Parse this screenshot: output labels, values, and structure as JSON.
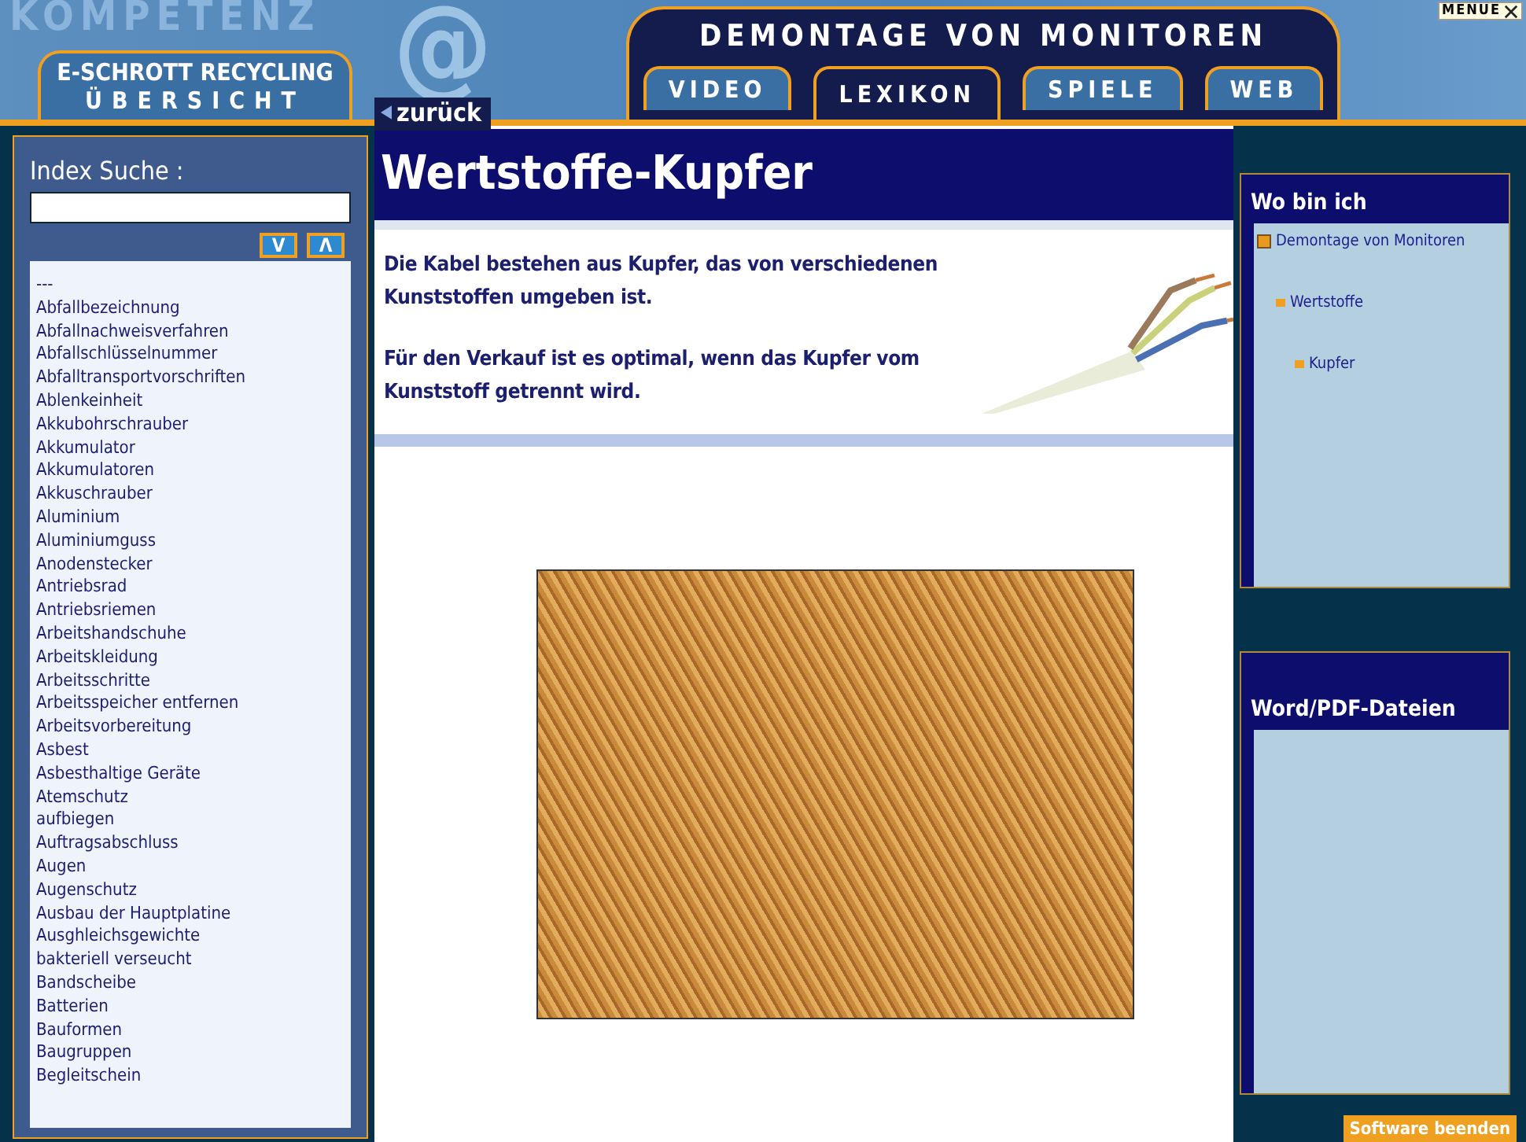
{
  "header": {
    "backdrop_text": "KOMPETENZ",
    "backdrop_symbol": "@",
    "overview_title": "E-SCHROTT RECYCLING",
    "overview_subtitle": "ÜBERSICHT",
    "section_title": "DEMONTAGE VON MONITOREN",
    "menu_button": "MENUE"
  },
  "tabs": [
    {
      "label": "VIDEO",
      "selected": false
    },
    {
      "label": "LEXIKON",
      "selected": true
    },
    {
      "label": "SPIELE",
      "selected": false
    },
    {
      "label": "WEB",
      "selected": false
    }
  ],
  "back_link": "zurück",
  "index": {
    "title": "Index Suche :",
    "down_button": "V",
    "up_button": "Λ",
    "items": [
      "---",
      "Abfallbezeichnung",
      "Abfallnachweisverfahren",
      "Abfallschlüsselnummer",
      "Abfalltransportvorschriften",
      "Ablenkeinheit",
      "Akkubohrschrauber",
      "Akkumulator",
      "Akkumulatoren",
      "Akkuschrauber",
      "Aluminium",
      "Aluminiumguss",
      "Anodenstecker",
      "Antriebsrad",
      "Antriebsriemen",
      "Arbeitshandschuhe",
      "Arbeitskleidung",
      "Arbeitsschritte",
      "Arbeitsspeicher entfernen",
      "Arbeitsvorbereitung",
      "Asbest",
      "Asbesthaltige Geräte",
      "Atemschutz",
      "aufbiegen",
      "Auftragsabschluss",
      "Augen",
      "Augenschutz",
      "Ausbau der Hauptplatine",
      "Ausghleichsgewichte",
      "bakteriell verseucht",
      "Bandscheibe",
      "Batterien",
      "Bauformen",
      "Baugruppen",
      "Begleitschein"
    ]
  },
  "article": {
    "title": "Wertstoffe-Kupfer",
    "paragraphs": [
      "Die Kabel bestehen aus Kupfer, das von verschiedenen Kunststoffen umgeben ist.",
      "Für den Verkauf ist es optimal, wenn das Kupfer vom Kunststoff getrennt wird."
    ]
  },
  "location": {
    "title": "Wo bin ich",
    "tree": [
      {
        "label": "Demontage von Monitoren",
        "children": [
          {
            "label": "Wertstoffe",
            "children": [
              {
                "label": "Kupfer"
              }
            ]
          }
        ]
      }
    ]
  },
  "files": {
    "title": "Word/PDF-Dateien"
  },
  "exit_button": "Software beenden"
}
